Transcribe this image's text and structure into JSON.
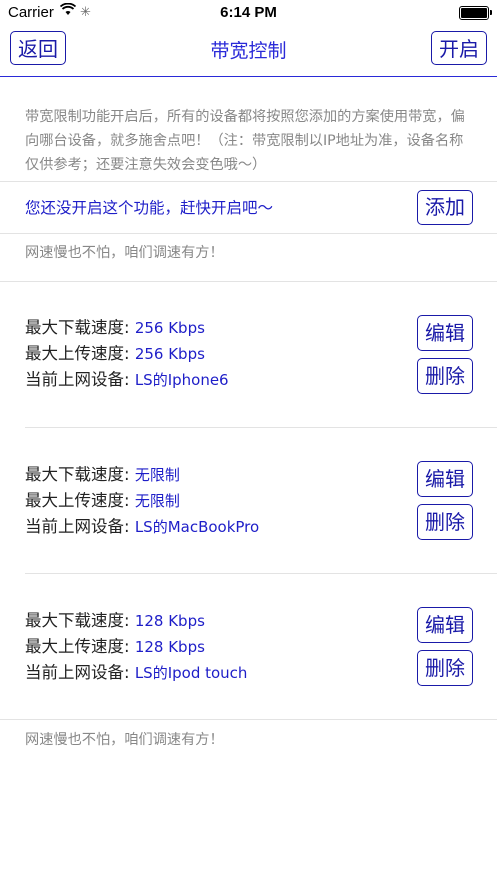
{
  "status_bar": {
    "carrier": "Carrier",
    "time": "6:14 PM"
  },
  "nav": {
    "back_label": "返回",
    "title": "带宽控制",
    "toggle_label": "开启"
  },
  "intro_text": "带宽限制功能开启后，所有的设备都将按照您添加的方案使用带宽，偏向哪台设备，就多施舍点吧！（注：带宽限制以IP地址为准，设备名称仅供参考；还要注意失效会变色哦～）",
  "notice": {
    "text": "您还没开启这个功能，赶快开启吧～",
    "add_label": "添加"
  },
  "tip_text": "网速慢也不怕，咱们调速有方！",
  "labels": {
    "download": "最大下载速度:",
    "upload": "最大上传速度:",
    "device": "当前上网设备:"
  },
  "rules": [
    {
      "download": "256 Kbps",
      "upload": "256 Kbps",
      "device": "LS的Iphone6",
      "edit_label": "编辑",
      "delete_label": "删除"
    },
    {
      "download": "无限制",
      "upload": "无限制",
      "device": "LS的MacBookPro",
      "edit_label": "编辑",
      "delete_label": "删除"
    },
    {
      "download": "128 Kbps",
      "upload": "128 Kbps",
      "device": "LS的Ipod touch",
      "edit_label": "编辑",
      "delete_label": "删除"
    }
  ],
  "colors": {
    "accent": "#1a1aa8",
    "value_text": "#1e1ec8",
    "muted_text": "#888888"
  }
}
